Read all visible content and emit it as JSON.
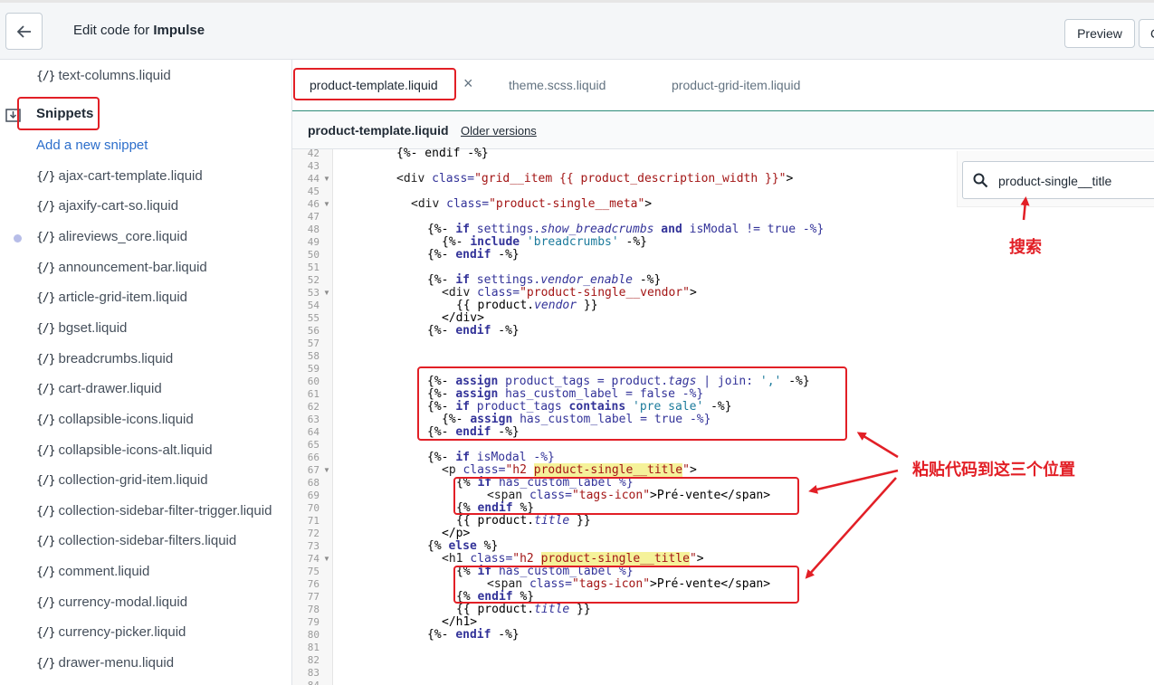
{
  "header": {
    "title_prefix": "Edit code for ",
    "title_theme": "Impulse",
    "preview_label": "Preview",
    "cut_label": "C"
  },
  "sidebar": {
    "top_item": "text-columns.liquid",
    "folder_label": "Snippets",
    "add_label": "Add a new snippet",
    "items": [
      "ajax-cart-template.liquid",
      "ajaxify-cart-so.liquid",
      "alireviews_core.liquid",
      "announcement-bar.liquid",
      "article-grid-item.liquid",
      "bgset.liquid",
      "breadcrumbs.liquid",
      "cart-drawer.liquid",
      "collapsible-icons.liquid",
      "collapsible-icons-alt.liquid",
      "collection-grid-item.liquid",
      "collection-sidebar-filter-trigger.liquid",
      "collection-sidebar-filters.liquid",
      "comment.liquid",
      "currency-modal.liquid",
      "currency-picker.liquid",
      "drawer-menu.liquid"
    ],
    "file_icon": "{/}"
  },
  "tabs": [
    {
      "label": "product-template.liquid"
    },
    {
      "label": "theme.scss.liquid"
    },
    {
      "label": "product-grid-item.liquid"
    }
  ],
  "tab_close": "×",
  "file_header": {
    "name": "product-template.liquid",
    "older_versions": "Older versions"
  },
  "search": {
    "value": "product-single__title"
  },
  "annotations": {
    "search_note": "搜索",
    "paste_note": "粘贴代码到这三个位置"
  },
  "line_numbers": [
    "42",
    "43",
    "44",
    "45",
    "46",
    "47",
    "48",
    "49",
    "50",
    "51",
    "52",
    "53",
    "54",
    "55",
    "56",
    "57",
    "58",
    "59",
    "60",
    "61",
    "62",
    "63",
    "64",
    "65",
    "66",
    "67",
    "68",
    "69",
    "70",
    "71",
    "72",
    "73",
    "74",
    "75",
    "76",
    "77",
    "78",
    "79",
    "80",
    "81",
    "82",
    "83",
    "84"
  ],
  "code": {
    "l42": "{%- endif -%}",
    "l44a": "<div ",
    "l44b": "class=",
    "l44c": "\"grid__item {{ product_description_width }}\"",
    "l44d": ">",
    "l46a": "<div ",
    "l46b": "class=",
    "l46c": "\"product-single__meta\"",
    "l46d": ">",
    "l48a": "{%- ",
    "l48b": "if",
    "l48c": " settings.",
    "l48d": "show_breadcrumbs",
    "l48e": " and",
    "l48f": " isModal != true -%}",
    "l49a": "{%- ",
    "l49b": "include",
    "l49c": " 'breadcrumbs'",
    "l49d": " -%}",
    "l50a": "{%- ",
    "l50b": "endif",
    "l50c": " -%}",
    "l52a": "{%- ",
    "l52b": "if",
    "l52c": " settings.",
    "l52d": "vendor_enable",
    "l52e": " -%}",
    "l53a": "<div ",
    "l53b": "class=",
    "l53c": "\"product-single__vendor\"",
    "l53d": ">",
    "l54a": "{{ product.",
    "l54b": "vendor",
    "l54c": " }}",
    "l55": "</div>",
    "l56a": "{%- ",
    "l56b": "endif",
    "l56c": " -%}",
    "l60a": "{%- ",
    "l60b": "assign",
    "l60c": " product_tags = product.",
    "l60d": "tags",
    "l60e": " | join: ",
    "l60f": "','",
    "l60g": " -%}",
    "l61a": "{%- ",
    "l61b": "assign",
    "l61c": " has_custom_label = false -%}",
    "l62a": "{%- ",
    "l62b": "if",
    "l62c": " product_tags ",
    "l62d": "contains",
    "l62e": " 'pre sale'",
    "l62f": " -%}",
    "l63a": "{%- ",
    "l63b": "assign",
    "l63c": " has_custom_label = true -%}",
    "l64a": "{%- ",
    "l64b": "endif",
    "l64c": " -%}",
    "l66a": "{%- ",
    "l66b": "if",
    "l66c": " isModal -%}",
    "l67a": "<p ",
    "l67b": "class=",
    "l67c": "\"h2 ",
    "l67d": "product-single__title",
    "l67e": "\"",
    "l67f": ">",
    "l68a": "{% ",
    "l68b": "if",
    "l68c": " has_custom_label %}",
    "l69a": "<span ",
    "l69b": "class=",
    "l69c": "\"tags-icon\"",
    "l69d": ">Pré-vente</span>",
    "l70a": "{% ",
    "l70b": "endif",
    "l70c": " %}",
    "l71a": "{{ product.",
    "l71b": "title",
    "l71c": " }}",
    "l72": "</p>",
    "l73a": "{% ",
    "l73b": "else",
    "l73c": " %}",
    "l74a": "<h1 ",
    "l74b": "class=",
    "l74c": "\"h2 ",
    "l74d": "product-single__title",
    "l74e": "\"",
    "l74f": ">",
    "l75a": "{% ",
    "l75b": "if",
    "l75c": " has_custom_label %}",
    "l76a": "<span ",
    "l76b": "class=",
    "l76c": "\"tags-icon\"",
    "l76d": ">Pré-vente</span>",
    "l77a": "{% ",
    "l77b": "endif",
    "l77c": " %}",
    "l78a": "{{ product.",
    "l78b": "title",
    "l78c": " }}",
    "l79": "</h1>",
    "l80a": "{%- ",
    "l80b": "endif",
    "l80c": " -%}"
  },
  "colors": {
    "annotation_red": "#e21f26",
    "link_blue": "#2c6ecb",
    "keyword": "#333399",
    "string": "#a31515",
    "highlight": "#f5f29a"
  }
}
